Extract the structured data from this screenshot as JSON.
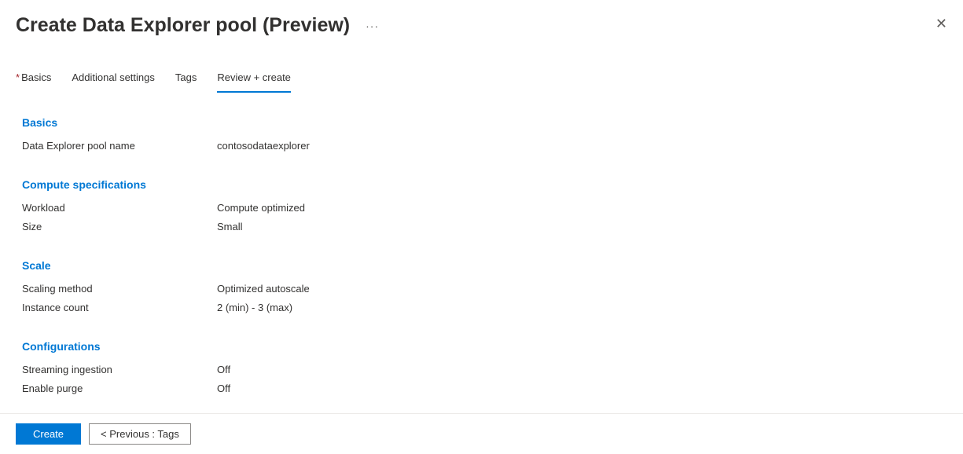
{
  "header": {
    "title": "Create Data Explorer pool (Preview)"
  },
  "tabs": {
    "basics": "Basics",
    "additional_settings": "Additional settings",
    "tags": "Tags",
    "review_create": "Review + create"
  },
  "sections": {
    "basics": {
      "title": "Basics",
      "pool_name_label": "Data Explorer pool name",
      "pool_name_value": "contosodataexplorer"
    },
    "compute": {
      "title": "Compute specifications",
      "workload_label": "Workload",
      "workload_value": "Compute optimized",
      "size_label": "Size",
      "size_value": "Small"
    },
    "scale": {
      "title": "Scale",
      "scaling_method_label": "Scaling method",
      "scaling_method_value": "Optimized autoscale",
      "instance_count_label": "Instance count",
      "instance_count_value": "2 (min) - 3 (max)"
    },
    "configurations": {
      "title": "Configurations",
      "streaming_label": "Streaming ingestion",
      "streaming_value": "Off",
      "purge_label": "Enable purge",
      "purge_value": "Off"
    }
  },
  "footer": {
    "create": "Create",
    "previous": "<  Previous : Tags"
  }
}
